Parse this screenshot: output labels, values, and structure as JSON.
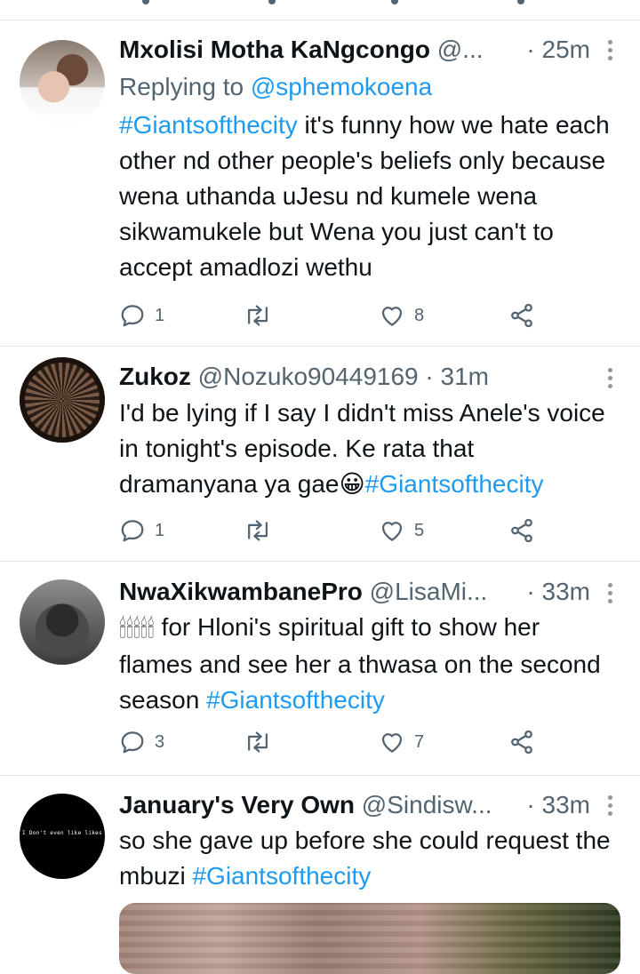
{
  "tweets": [
    {
      "name": "Mxolisi Motha KaNgcongo",
      "handle": "@...",
      "separator": "·",
      "time": "25m",
      "replying_prefix": "Replying to ",
      "replying_to": "@sphemokoena",
      "body_parts": [
        {
          "type": "hashtag",
          "text": "#Giantsofthecity"
        },
        {
          "type": "text",
          "text": "  it's funny how we hate each other nd other people's beliefs only because wena uthanda uJesu nd kumele wena sikwamukele but Wena you just can't to accept amadlozi wethu"
        }
      ],
      "replies": "1",
      "retweets": "",
      "likes": "8",
      "avatar": "profile-photo-couple"
    },
    {
      "name": "Zukoz",
      "handle": "@Nozuko90449169",
      "separator": "·",
      "time": "31m",
      "body_parts": [
        {
          "type": "text",
          "text": "I'd be lying if I say I didn't miss Anele's voice in tonight's episode. Ke rata that dramanyana ya gae"
        },
        {
          "type": "emoji",
          "text": "😀"
        },
        {
          "type": "hashtag",
          "text": "#Giantsofthecity"
        }
      ],
      "replies": "1",
      "retweets": "",
      "likes": "5",
      "avatar": "profile-photo-woven-basket"
    },
    {
      "name": "NwaXikwambanePro",
      "handle": "@LisaMi...",
      "separator": "·",
      "time": "33m",
      "candles": "🕯🕯🕯🕯🕯",
      "body_parts": [
        {
          "type": "text",
          "text": "  for Hloni's spiritual gift to show her flames and see her a thwasa on the second season "
        },
        {
          "type": "hashtag",
          "text": "#Giantsofthecity"
        }
      ],
      "replies": "3",
      "retweets": "",
      "likes": "7",
      "avatar": "profile-photo-portrait"
    },
    {
      "name": "January's Very Own",
      "handle": "@Sindisw...",
      "separator": "·",
      "time": "33m",
      "avatar_text": "I Don't even like likes",
      "body_parts": [
        {
          "type": "text",
          "text": "so she gave up before she could request the mbuzi "
        },
        {
          "type": "hashtag",
          "text": "#Giantsofthecity"
        }
      ],
      "avatar": "profile-text-black-circle"
    }
  ],
  "icons": {
    "reply": "reply-icon",
    "retweet": "retweet-icon",
    "like": "heart-icon",
    "share": "share-icon",
    "more": "more-vertical-icon"
  },
  "colors": {
    "link": "#1d9bf0",
    "secondary_text": "#536471",
    "divider": "#e1e5e8"
  }
}
